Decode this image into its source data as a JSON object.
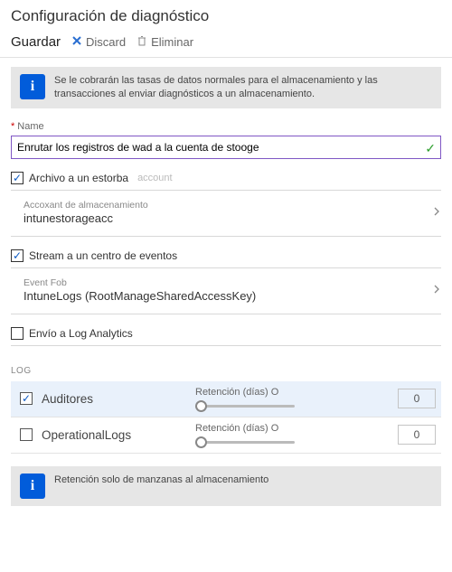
{
  "header": {
    "title": "Configuración de diagnóstico"
  },
  "toolbar": {
    "save": "Guardar",
    "discard": "Discard",
    "delete": "Eliminar"
  },
  "info1": "Se le cobrarán las tasas de datos normales para el almacenamiento y las transacciones al enviar diagnósticos a un almacenamiento.",
  "name": {
    "label": "Name",
    "value": "Enrutar los registros de wad a la cuenta de stooge"
  },
  "archive": {
    "label": "Archivo a un estorba",
    "ghost": "account",
    "checked": true,
    "account_label": "Accoxant de almacenamiento",
    "account_value": "intunestorageacc"
  },
  "stream": {
    "label": "Stream a un centro de eventos",
    "checked": true,
    "hub_label": "Event Fob",
    "hub_value": "IntuneLogs (RootManageSharedAccessKey)"
  },
  "la": {
    "label": "Envío a Log Analytics",
    "checked": false
  },
  "log": {
    "heading": "LOG",
    "retention_label": "Retención (días) O",
    "rows": [
      {
        "name": "Auditores",
        "checked": true,
        "retention": "0"
      },
      {
        "name": "OperationalLogs",
        "checked": false,
        "retention": "0"
      }
    ]
  },
  "info2": "Retención solo de manzanas al almacenamiento"
}
